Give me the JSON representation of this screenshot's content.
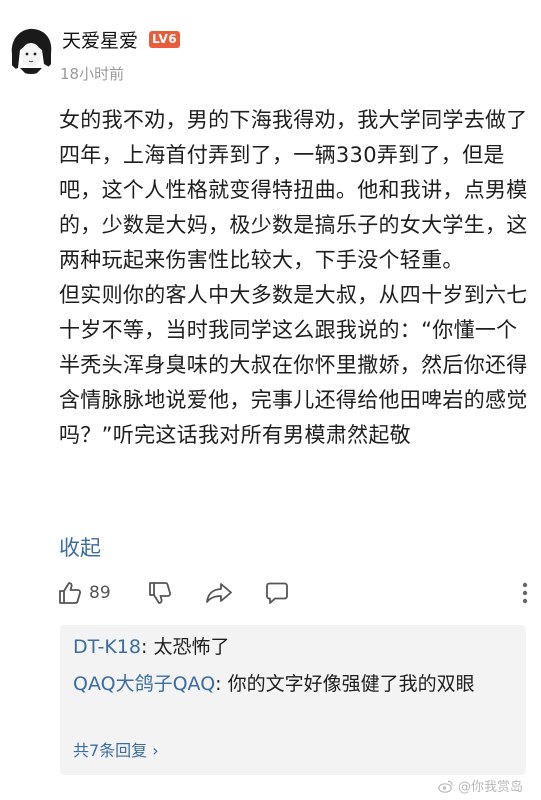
{
  "post": {
    "author": "天爱星爱",
    "level": "LV6",
    "time": "18小时前",
    "body": "女的我不劝，男的下海我得劝，我大学同学去做了四年，上海首付弄到了，一辆330弄到了，但是吧，这个人性格就变得特扭曲。他和我讲，点男模的，少数是大妈，极少数是搞乐子的女大学生，这两种玩起来伤害性比较大，下手没个轻重。\n但实则你的客人中大多数是大叔，从四十岁到六七十岁不等，当时我同学这么跟我说的：“你懂一个半秃头浑身臭味的大叔在你怀里撒娇，然后你还得含情脉脉地说爱他，完事儿还得给他田啤岩的感觉吗？”听完这话我对所有男模肃然起敬",
    "collapse_label": "收起"
  },
  "actions": {
    "like_count": "89",
    "icons": [
      "thumbs-up-icon",
      "thumbs-down-icon",
      "share-icon",
      "comment-icon",
      "more-icon"
    ]
  },
  "replies": [
    {
      "name": "DT-K18",
      "sep": ": ",
      "text": "太恐怖了"
    },
    {
      "name": "QAQ大鸽子QAQ",
      "sep": ": ",
      "text": "你的文字好像强健了我的双眼"
    }
  ],
  "replies_more": "共7条回复 ›",
  "watermark": "@你我赏岛"
}
